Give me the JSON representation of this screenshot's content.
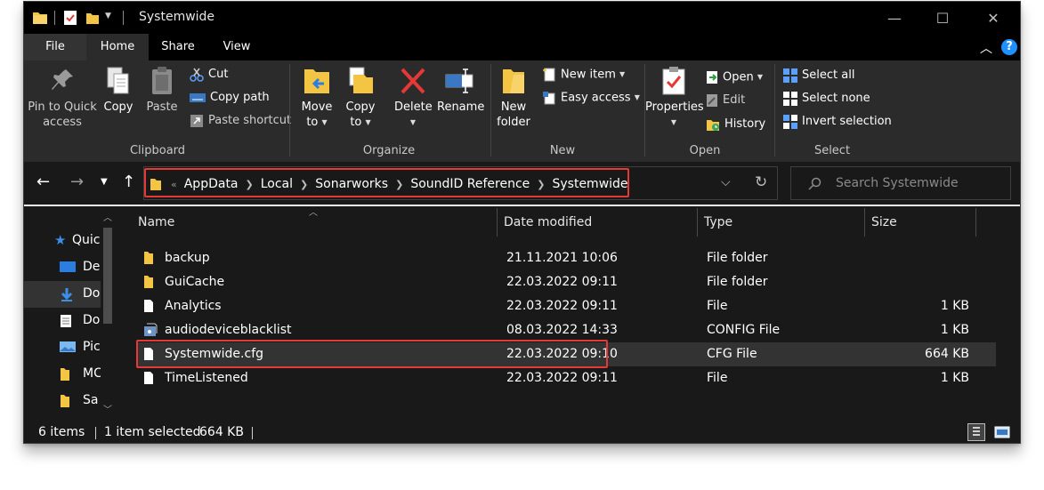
{
  "window": {
    "title": "Systemwide",
    "controls": {
      "minimize": "—",
      "maximize": "☐",
      "close": "✕"
    }
  },
  "ribbon_tabs": [
    "File",
    "Home",
    "Share",
    "View"
  ],
  "ribbon": {
    "clipboard": {
      "label": "Clipboard",
      "pin_label_line1": "Pin to Quick",
      "pin_label_line2": "access",
      "copy": "Copy",
      "paste": "Paste",
      "cut": "Cut",
      "copy_path": "Copy path",
      "paste_shortcut": "Paste shortcut"
    },
    "organize": {
      "label": "Organize",
      "move_to_line1": "Move",
      "move_to_line2": "to",
      "copy_to_line1": "Copy",
      "copy_to_line2": "to",
      "delete": "Delete",
      "rename": "Rename"
    },
    "new": {
      "label": "New",
      "new_folder_line1": "New",
      "new_folder_line2": "folder",
      "new_item": "New item",
      "easy_access": "Easy access"
    },
    "open": {
      "label": "Open",
      "properties": "Properties",
      "open": "Open",
      "edit": "Edit",
      "history": "History"
    },
    "select": {
      "label": "Select",
      "select_all": "Select all",
      "select_none": "Select none",
      "invert_selection": "Invert selection"
    }
  },
  "address": {
    "overflow": "«",
    "crumbs": [
      "AppData",
      "Local",
      "Sonarworks",
      "SoundID Reference",
      "Systemwide"
    ],
    "search_placeholder": "Search Systemwide"
  },
  "nav_pane": [
    {
      "label": "Quic",
      "icon": "star-icon"
    },
    {
      "label": "De",
      "icon": "desktop-icon"
    },
    {
      "label": "Do",
      "icon": "download-icon"
    },
    {
      "label": "Do",
      "icon": "document-icon"
    },
    {
      "label": "Pic",
      "icon": "picture-icon"
    },
    {
      "label": "MC",
      "icon": "folder-icon"
    },
    {
      "label": "Sa",
      "icon": "folder-icon"
    }
  ],
  "columns": {
    "name": "Name",
    "date": "Date modified",
    "type": "Type",
    "size": "Size"
  },
  "files": [
    {
      "name": "backup",
      "date": "21.11.2021 10:06",
      "type": "File folder",
      "size": "",
      "icon": "folder-icon"
    },
    {
      "name": "GuiCache",
      "date": "22.03.2022 09:11",
      "type": "File folder",
      "size": "",
      "icon": "folder-icon"
    },
    {
      "name": "Analytics",
      "date": "22.03.2022 09:11",
      "type": "File",
      "size": "1 KB",
      "icon": "file-icon"
    },
    {
      "name": "audiodeviceblacklist",
      "date": "08.03.2022 14:33",
      "type": "CONFIG File",
      "size": "1 KB",
      "icon": "config-file-icon"
    },
    {
      "name": "Systemwide.cfg",
      "date": "22.03.2022 09:10",
      "type": "CFG File",
      "size": "664 KB",
      "icon": "file-icon",
      "selected": true
    },
    {
      "name": "TimeListened",
      "date": "22.03.2022 09:11",
      "type": "File",
      "size": "1 KB",
      "icon": "file-icon"
    }
  ],
  "status": {
    "items": "6 items",
    "selected": "1 item selected",
    "selected_size": "664 KB"
  },
  "colors": {
    "highlight": "#e53935",
    "folder": "#f4c542",
    "accent": "#1e90ff"
  }
}
